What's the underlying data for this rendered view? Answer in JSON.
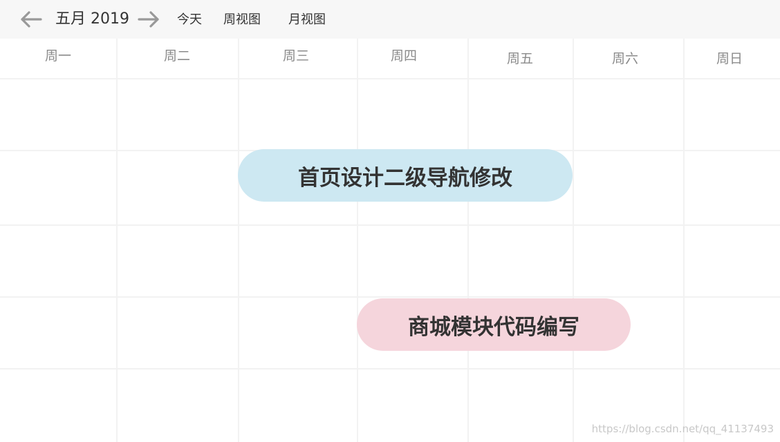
{
  "toolbar": {
    "prev_icon": "arrow-left-icon",
    "next_icon": "arrow-right-icon",
    "month_title": "五月 2019",
    "today_label": "今天",
    "week_view_label": "周视图",
    "month_view_label": "月视图"
  },
  "weekdays": [
    "周一",
    "周二",
    "周三",
    "周四",
    "周五",
    "周六",
    "周日"
  ],
  "events": [
    {
      "title": "首页设计二级导航修改",
      "color": "#cde8f2",
      "start_day": "周三",
      "end_day": "周五"
    },
    {
      "title": "商城模块代码编写",
      "color": "#f5d5dc",
      "start_day": "周四",
      "end_day": "周六"
    }
  ],
  "watermark": "https://blog.csdn.net/qq_41137493",
  "colors": {
    "toolbar_bg": "#f7f7f7",
    "grid_line": "#f2f2f2",
    "header_text": "#8a8a8a",
    "arrow": "#999999"
  }
}
